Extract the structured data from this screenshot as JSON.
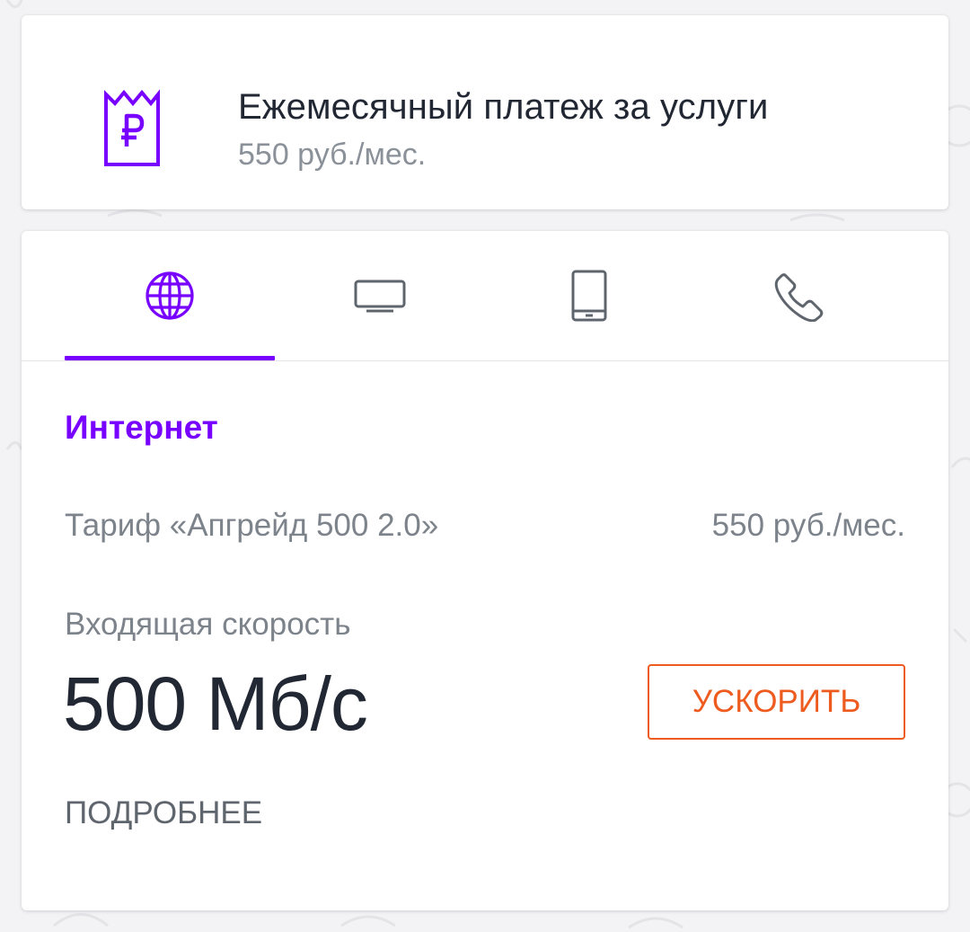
{
  "payment": {
    "icon": "ruble-receipt-icon",
    "title": "Ежемесячный платеж за услуги",
    "subtitle": "550 руб./мес."
  },
  "tabs": [
    {
      "icon": "globe-icon",
      "active": true
    },
    {
      "icon": "tv-icon",
      "active": false
    },
    {
      "icon": "mobile-phone-icon",
      "active": false
    },
    {
      "icon": "phone-handset-icon",
      "active": false
    }
  ],
  "internet": {
    "section_title": "Интернет",
    "tariff_name": "Тариф «Апгрейд 500 2.0»",
    "tariff_price": "550 руб./мес.",
    "speed_label": "Входящая скорость",
    "speed_value": "500 Мб/с",
    "boost_label": "УСКОРИТЬ",
    "more_label": "ПОДРОБНЕЕ"
  },
  "colors": {
    "accent": "#7700ff",
    "action": "#ee5b1f",
    "text_primary": "#212733",
    "text_secondary": "#7d838b"
  }
}
